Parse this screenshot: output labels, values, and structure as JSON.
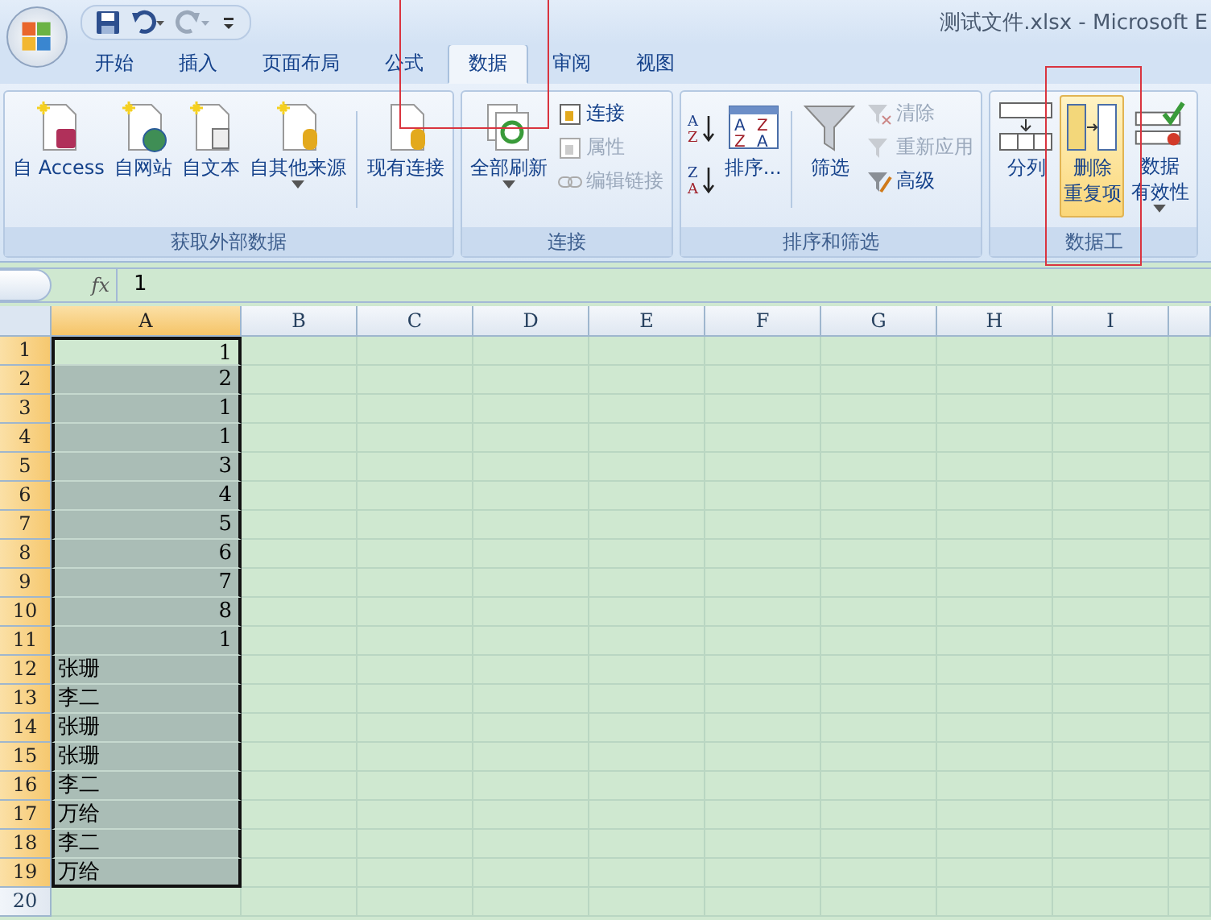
{
  "window": {
    "title": "测试文件.xlsx - Microsoft E"
  },
  "tabs": [
    {
      "label": "开始",
      "selected": false
    },
    {
      "label": "插入",
      "selected": false
    },
    {
      "label": "页面布局",
      "selected": false
    },
    {
      "label": "公式",
      "selected": false
    },
    {
      "label": "数据",
      "selected": true
    },
    {
      "label": "审阅",
      "selected": false
    },
    {
      "label": "视图",
      "selected": false
    }
  ],
  "ribbon_groups": [
    {
      "label": "获取外部数据",
      "large": [
        {
          "kind": "access",
          "lines": [
            "自 Access"
          ],
          "dropdown": false,
          "highlighted": false
        },
        {
          "kind": "web",
          "lines": [
            "自网站"
          ],
          "dropdown": false,
          "highlighted": false
        },
        {
          "kind": "text",
          "lines": [
            "自文本"
          ],
          "dropdown": false,
          "highlighted": false
        },
        {
          "kind": "other",
          "lines": [
            "自其他来源"
          ],
          "dropdown": true,
          "highlighted": false
        },
        {
          "kind": "existing",
          "lines": [
            "现有连接"
          ],
          "dropdown": false,
          "highlighted": false
        }
      ]
    },
    {
      "label": "连接",
      "large": [
        {
          "kind": "refresh",
          "lines": [
            "全部刷新"
          ],
          "dropdown": true,
          "highlighted": false
        }
      ],
      "small": [
        {
          "kind": "connections",
          "label": "连接",
          "disabled": false
        },
        {
          "kind": "properties",
          "label": "属性",
          "disabled": true
        },
        {
          "kind": "links",
          "label": "编辑链接",
          "disabled": true
        }
      ]
    },
    {
      "label": "排序和筛选",
      "sort": [
        {
          "letters": [
            "A",
            "Z"
          ]
        },
        {
          "letters": [
            "Z",
            "A"
          ]
        }
      ],
      "large": [
        {
          "kind": "sort",
          "letters": [
            "A",
            "Z",
            "Z",
            "A"
          ],
          "lines": [
            "排序..."
          ],
          "dropdown": false,
          "highlighted": false
        },
        {
          "kind": "filter",
          "lines": [
            "筛选"
          ],
          "dropdown": false,
          "highlighted": false
        }
      ],
      "small": [
        {
          "kind": "clear",
          "label": "清除",
          "disabled": true
        },
        {
          "kind": "reapply",
          "label": "重新应用",
          "disabled": true
        },
        {
          "kind": "advanced",
          "label": "高级",
          "disabled": false
        }
      ]
    },
    {
      "label": "数据工",
      "large": [
        {
          "kind": "split",
          "lines": [
            "分列"
          ],
          "dropdown": false,
          "highlighted": false
        },
        {
          "kind": "dedupe",
          "lines": [
            "删除",
            "重复项"
          ],
          "dropdown": false,
          "highlighted": true
        },
        {
          "kind": "validation",
          "lines": [
            "数据",
            "有效性"
          ],
          "dropdown": true,
          "highlighted": false
        }
      ]
    }
  ],
  "formula_bar": {
    "fx": "fx",
    "value": "1"
  },
  "columns": [
    {
      "label": "A",
      "selected": true
    },
    {
      "label": "B",
      "selected": false
    },
    {
      "label": "C",
      "selected": false
    },
    {
      "label": "D",
      "selected": false
    },
    {
      "label": "E",
      "selected": false
    },
    {
      "label": "F",
      "selected": false
    },
    {
      "label": "G",
      "selected": false
    },
    {
      "label": "H",
      "selected": false
    },
    {
      "label": "I",
      "selected": false
    }
  ],
  "rows": [
    {
      "header": "1",
      "value": "1",
      "kind": "number",
      "selected": true
    },
    {
      "header": "2",
      "value": "2",
      "kind": "number",
      "selected": true
    },
    {
      "header": "3",
      "value": "1",
      "kind": "number",
      "selected": true
    },
    {
      "header": "4",
      "value": "1",
      "kind": "number",
      "selected": true
    },
    {
      "header": "5",
      "value": "3",
      "kind": "number",
      "selected": true
    },
    {
      "header": "6",
      "value": "4",
      "kind": "number",
      "selected": true
    },
    {
      "header": "7",
      "value": "5",
      "kind": "number",
      "selected": true
    },
    {
      "header": "8",
      "value": "6",
      "kind": "number",
      "selected": true
    },
    {
      "header": "9",
      "value": "7",
      "kind": "number",
      "selected": true
    },
    {
      "header": "10",
      "value": "8",
      "kind": "number",
      "selected": true
    },
    {
      "header": "11",
      "value": "1",
      "kind": "number",
      "selected": true
    },
    {
      "header": "12",
      "value": "张珊",
      "kind": "text",
      "selected": true
    },
    {
      "header": "13",
      "value": "李二",
      "kind": "text",
      "selected": true
    },
    {
      "header": "14",
      "value": "张珊",
      "kind": "text",
      "selected": true
    },
    {
      "header": "15",
      "value": "张珊",
      "kind": "text",
      "selected": true
    },
    {
      "header": "16",
      "value": "李二",
      "kind": "text",
      "selected": true
    },
    {
      "header": "17",
      "value": "万给",
      "kind": "text",
      "selected": true
    },
    {
      "header": "18",
      "value": "李二",
      "kind": "text",
      "selected": true
    },
    {
      "header": "19",
      "value": "万给",
      "kind": "text",
      "selected": true
    },
    {
      "header": "20",
      "kind": "empty",
      "selected": false
    }
  ]
}
